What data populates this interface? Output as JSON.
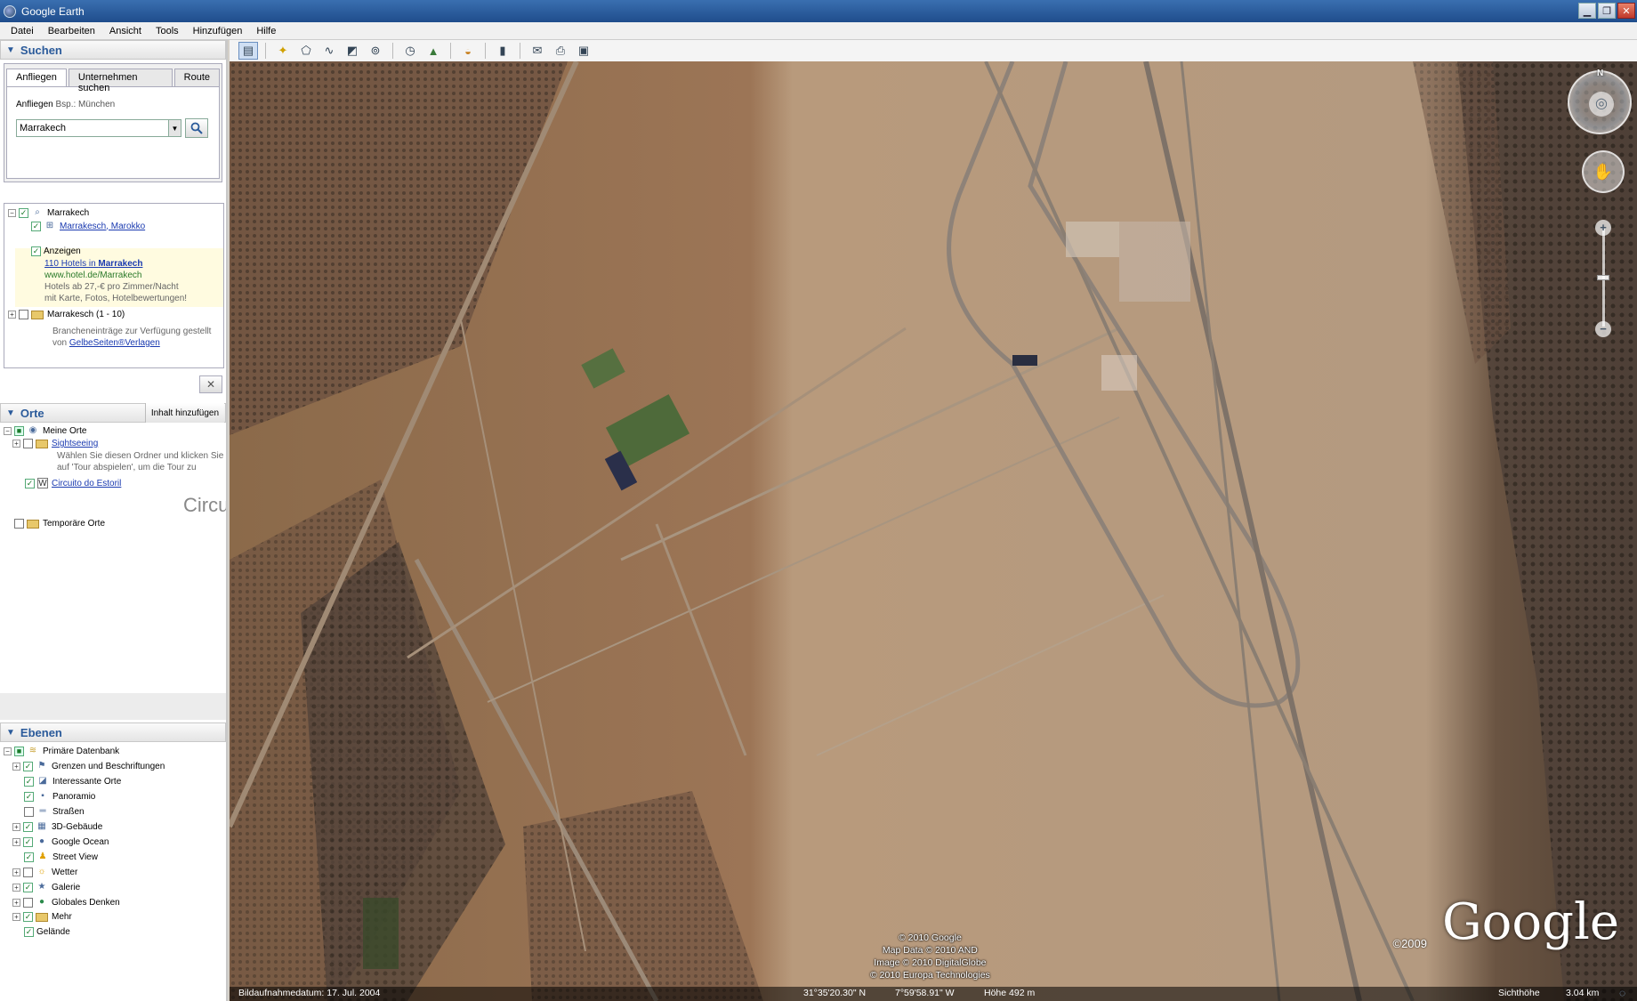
{
  "window": {
    "title": "Google Earth"
  },
  "menu": [
    "Datei",
    "Bearbeiten",
    "Ansicht",
    "Tools",
    "Hinzufügen",
    "Hilfe"
  ],
  "search": {
    "header": "Suchen",
    "tabs": [
      "Anfliegen",
      "Unternehmen suchen",
      "Route"
    ],
    "fly_label": "Anfliegen",
    "fly_hint": "Bsp.: München",
    "query": "Marrakech",
    "results": {
      "root": "Marrakech",
      "item1": "Marrakesch, Marokko",
      "ads_label": "Anzeigen",
      "ad_title_prefix": "110 Hotels in ",
      "ad_title_bold": "Marrakech",
      "ad_url": "www.hotel.de/Marrakech",
      "ad_line1": "Hotels ab 27,-€ pro Zimmer/Nacht",
      "ad_line2": "mit Karte, Fotos, Hotelbewertungen!",
      "group": "Marrakesch (1 - 10)",
      "credit_line1": "Brancheneinträge zur Verfügung gestellt",
      "credit_prefix": "von ",
      "credit_link": "GelbeSeiten®Verlagen"
    }
  },
  "places": {
    "header": "Orte",
    "add_content": "Inhalt hinzufügen",
    "my_places": "Meine Orte",
    "sightseeing": "Sightseeing",
    "sightseeing_desc1": "Wählen Sie diesen Ordner und klicken Sie",
    "sightseeing_desc2": "auf 'Tour abspielen', um die Tour zu",
    "circuito": "Circuito do Estoril",
    "circuito_big": "Circu",
    "temp": "Temporäre Orte"
  },
  "layers": {
    "header": "Ebenen",
    "primary": "Primäre Datenbank",
    "items": [
      {
        "label": "Grenzen und Beschriftungen",
        "checked": true,
        "icon": "flag-icon"
      },
      {
        "label": "Interessante Orte",
        "checked": true,
        "icon": "poi-icon"
      },
      {
        "label": "Panoramio",
        "checked": true,
        "icon": "photo-icon"
      },
      {
        "label": "Straßen",
        "checked": false,
        "icon": "road-icon"
      },
      {
        "label": "3D-Gebäude",
        "checked": true,
        "icon": "building-icon"
      },
      {
        "label": "Google Ocean",
        "checked": true,
        "icon": "globe-icon"
      },
      {
        "label": "Street View",
        "checked": true,
        "icon": "pegman-icon"
      },
      {
        "label": "Wetter",
        "checked": false,
        "icon": "sun-icon"
      },
      {
        "label": "Galerie",
        "checked": true,
        "icon": "star-icon"
      },
      {
        "label": "Globales Denken",
        "checked": false,
        "icon": "globe-icon"
      },
      {
        "label": "Mehr",
        "checked": true,
        "icon": "folder-icon"
      },
      {
        "label": "Gelände",
        "checked": true,
        "icon": "none"
      }
    ]
  },
  "map": {
    "copyright": [
      "© 2010 Google",
      "Map Data © 2010 AND",
      "Image © 2010 DigitalGlobe",
      "© 2010 Europa Technologies"
    ],
    "logo": "Google",
    "logo_year": "©2009",
    "compass_n": "N",
    "status": {
      "date": "Bildaufnahmedatum: 17. Jul. 2004",
      "lat": "31°35'20.30\" N",
      "lon": "7°59'58.91\" W",
      "elev": "Höhe 492 m",
      "eye": "Sichthöhe",
      "eye_val": "3.04 km"
    }
  }
}
